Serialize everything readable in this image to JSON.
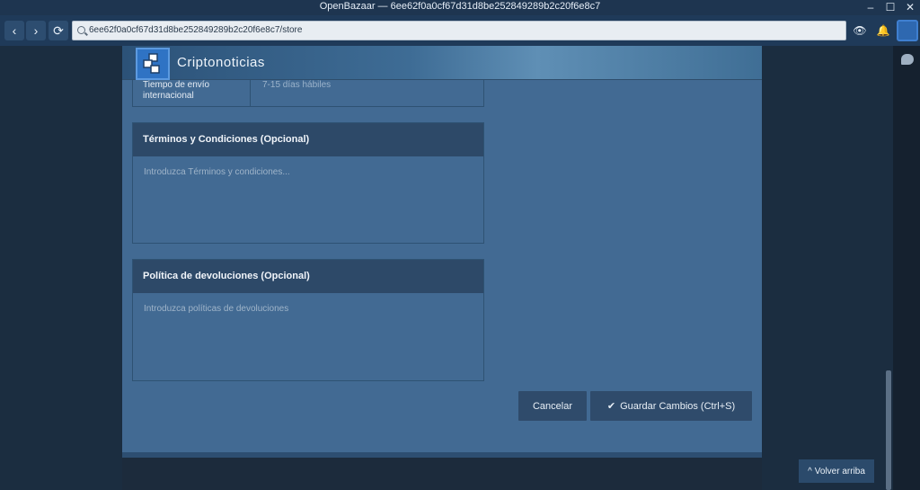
{
  "window": {
    "title": "OpenBazaar — 6ee62f0a0cf67d31d8be252849289b2c20f6e8c7",
    "controls": [
      "–",
      "☐",
      "✕"
    ]
  },
  "nav": {
    "back_icon": "‹",
    "forward_icon": "›",
    "refresh_icon": "⟳",
    "address": "6ee62f0a0cf67d31d8be252849289b2c20f6e8c7/store",
    "view_icon": "👁",
    "notif_icon": "🔔"
  },
  "store": {
    "name": "Criptonoticias"
  },
  "shipping_fragment": {
    "label": "Tiempo de envío internacional",
    "value": "7-15 días hábiles"
  },
  "terms": {
    "title": "Términos y Condiciones (Opcional)",
    "placeholder": "Introduzca Términos y condiciones..."
  },
  "returns": {
    "title": "Política de devoluciones (Opcional)",
    "placeholder": "Introduzca políticas de devoluciones"
  },
  "actions": {
    "cancel": "Cancelar",
    "save": "Guardar Cambios (Ctrl+S)",
    "save_check": "✔"
  },
  "scroll_top": {
    "icon": "^",
    "label": "Volver arriba"
  }
}
